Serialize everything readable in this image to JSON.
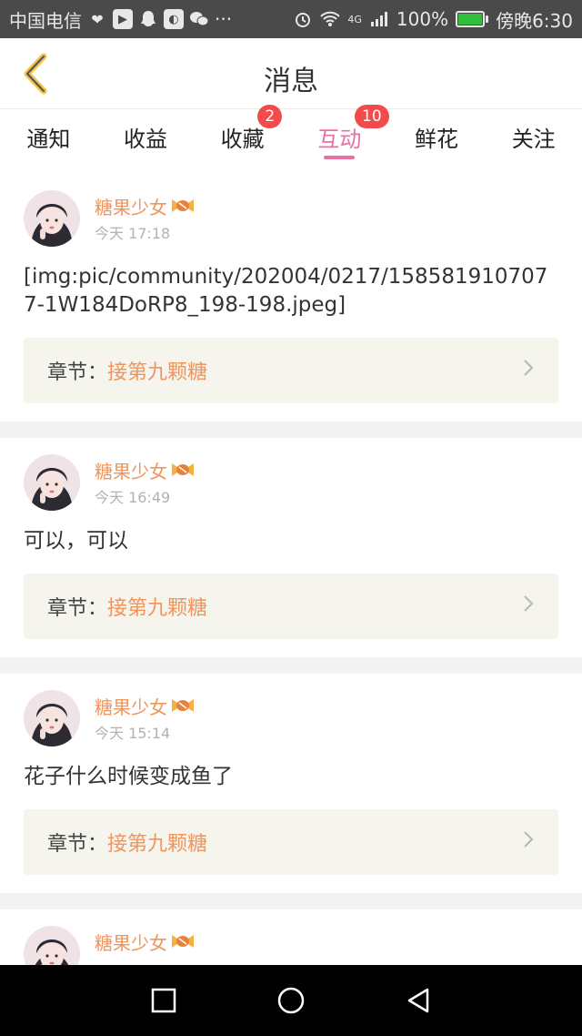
{
  "status_bar": {
    "carrier": "中国电信",
    "battery": "100%",
    "time": "傍晚6:30",
    "network": "4G"
  },
  "header": {
    "title": "消息",
    "back_icon": "back-chevron-icon"
  },
  "tabs": [
    {
      "label": "通知",
      "badge": null,
      "active": false
    },
    {
      "label": "收益",
      "badge": null,
      "active": false
    },
    {
      "label": "收藏",
      "badge": "2",
      "active": false
    },
    {
      "label": "互动",
      "badge": "10",
      "active": true
    },
    {
      "label": "鲜花",
      "badge": null,
      "active": false
    },
    {
      "label": "关注",
      "badge": null,
      "active": false
    }
  ],
  "messages": [
    {
      "username": "糖果少女",
      "time": "今天 17:18",
      "content": "[img:pic/community/202004/0217/1585819107077-1W184DoRP8_198-198.jpeg]",
      "chapter_label": "章节：",
      "chapter_name": "接第九颗糖"
    },
    {
      "username": "糖果少女",
      "time": "今天 16:49",
      "content": "可以，可以",
      "chapter_label": "章节：",
      "chapter_name": "接第九颗糖"
    },
    {
      "username": "糖果少女",
      "time": "今天 15:14",
      "content": "花子什么时候变成鱼了",
      "chapter_label": "章节：",
      "chapter_name": "接第九颗糖"
    },
    {
      "username": "糖果少女",
      "time": "",
      "content": "",
      "chapter_label": "",
      "chapter_name": ""
    }
  ],
  "colors": {
    "accent_pink": "#ea6fa3",
    "badge_red": "#f14b4b",
    "username_orange": "#f0955d",
    "chapter_bg": "#f5f4ed"
  }
}
